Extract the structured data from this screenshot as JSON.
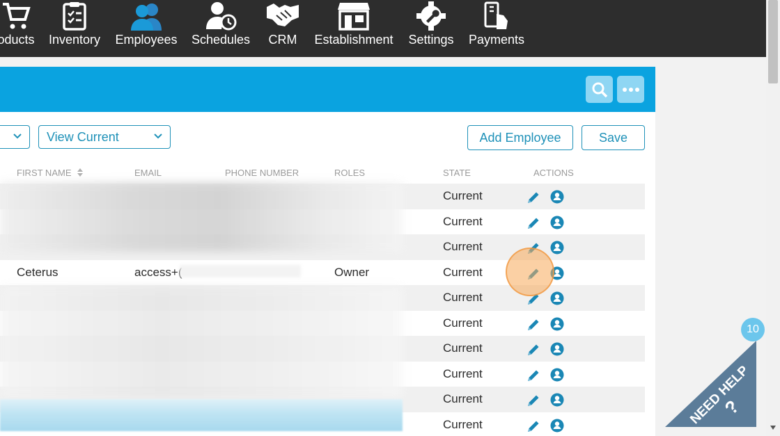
{
  "nav": {
    "items": [
      {
        "label": "oducts",
        "icon": "cart-icon"
      },
      {
        "label": "Inventory",
        "icon": "clipboard-icon"
      },
      {
        "label": "Employees",
        "icon": "users-icon"
      },
      {
        "label": "Schedules",
        "icon": "user-clock-icon"
      },
      {
        "label": "CRM",
        "icon": "handshake-icon"
      },
      {
        "label": "Establishment",
        "icon": "store-icon"
      },
      {
        "label": "Settings",
        "icon": "gear-icon"
      },
      {
        "label": "Payments",
        "icon": "payment-icon"
      }
    ],
    "active": "Employees"
  },
  "toolbar": {
    "filter_select_value": "",
    "view_select_value": "View Current",
    "add_employee_label": "Add Employee",
    "save_label": "Save"
  },
  "table": {
    "columns": {
      "first_name": "FIRST NAME",
      "email": "EMAIL",
      "phone": "PHONE NUMBER",
      "roles": "ROLES",
      "state": "STATE",
      "actions": "ACTIONS"
    },
    "rows": [
      {
        "first_name": "",
        "email": "",
        "roles": "",
        "state": "Current"
      },
      {
        "first_name": "",
        "email": "",
        "roles": "",
        "state": "Current"
      },
      {
        "first_name": "",
        "email": "",
        "roles": "",
        "state": "Current"
      },
      {
        "first_name": "Ceterus",
        "email": "access+(",
        "roles": "Owner",
        "state": "Current"
      },
      {
        "first_name": "",
        "email": "",
        "roles": "",
        "state": "Current"
      },
      {
        "first_name": "",
        "email": "",
        "roles": "",
        "state": "Current"
      },
      {
        "first_name": "",
        "email": "",
        "roles": "",
        "state": "Current"
      },
      {
        "first_name": "",
        "email": "",
        "roles": "",
        "state": "Current"
      },
      {
        "first_name": "",
        "email": "",
        "roles": "",
        "state": "Current"
      },
      {
        "first_name": "",
        "email": "",
        "roles": "",
        "state": "Current"
      }
    ]
  },
  "help": {
    "label": "NEED HELP",
    "badge_count": "10"
  },
  "colors": {
    "accent": "#0aa3e0",
    "nav_bg": "#2d2d2d",
    "link": "#1e91b8",
    "action_icon": "#1a87b5"
  }
}
